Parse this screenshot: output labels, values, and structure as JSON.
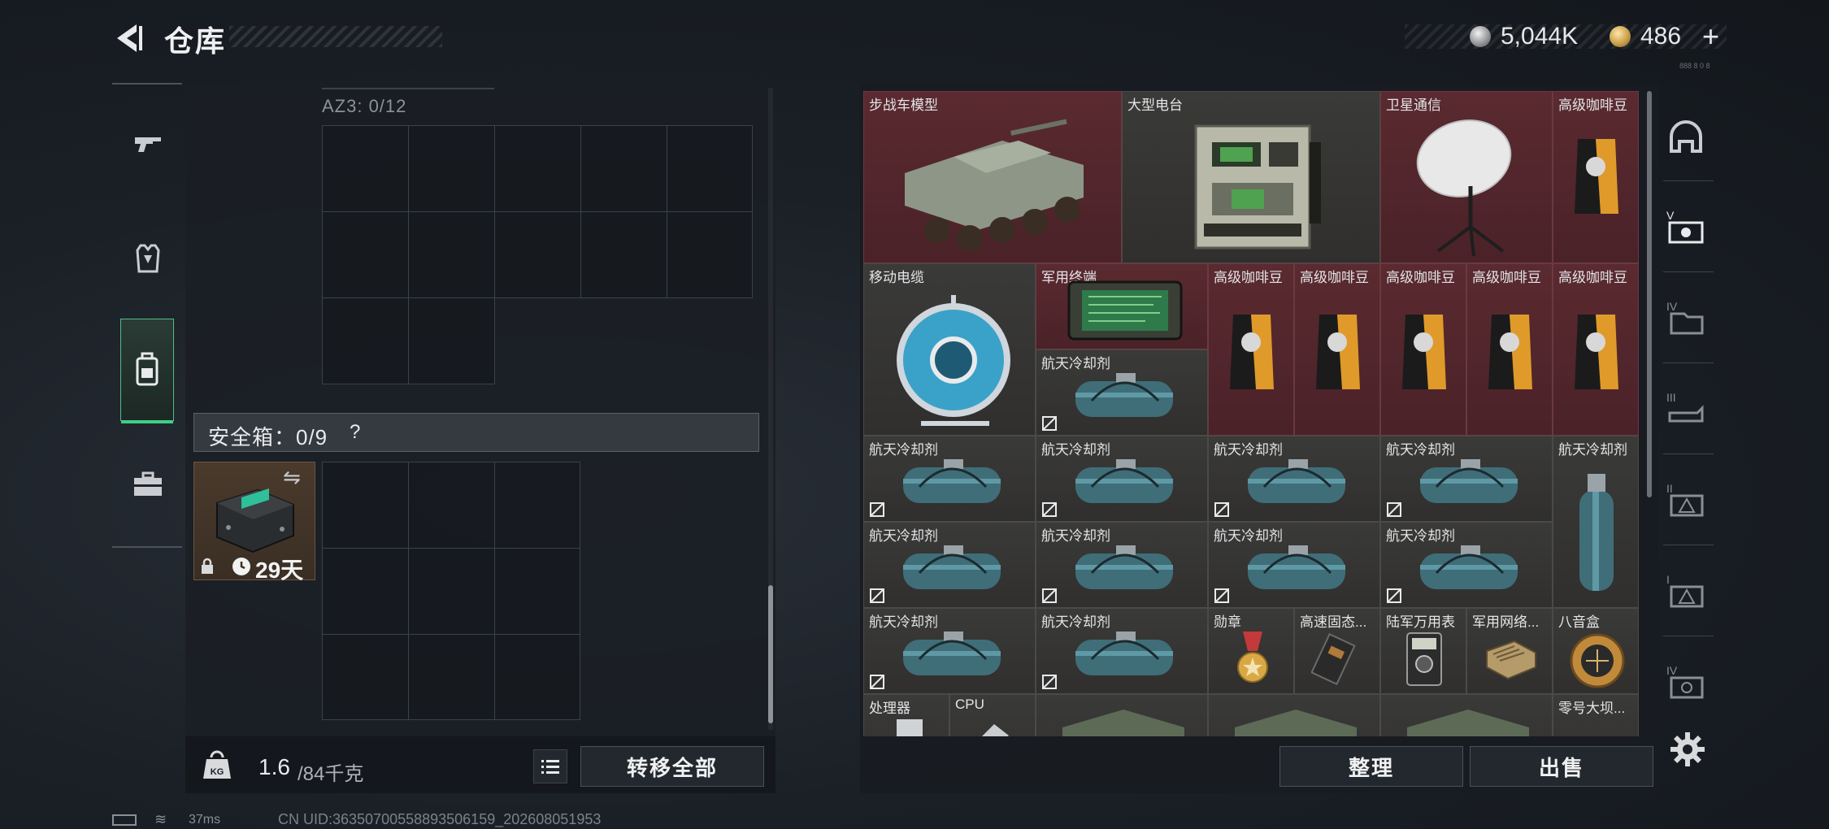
{
  "header": {
    "title": "仓库",
    "back_icon": "back-arrow-icon"
  },
  "currency": {
    "silver_value": "5,044K",
    "gold_value": "486",
    "gold_add_label": "+",
    "code_text": "888 8 0 8"
  },
  "left_rail": {
    "tabs": [
      {
        "icon": "gun-icon"
      },
      {
        "icon": "vest-icon"
      },
      {
        "icon": "backpack-icon",
        "active": true
      },
      {
        "icon": "toolbox-icon"
      }
    ]
  },
  "backpack": {
    "az3_label": "AZ3: 0/12",
    "safe_box_label": "安全箱：0/9",
    "safe_help_label": "?",
    "safe_item_days": "29天",
    "weight_current": "1.6",
    "weight_max": "/84千克",
    "transfer_all_label": "转移全部"
  },
  "warehouse": {
    "items": [
      {
        "name": "步战车模型",
        "color": "red",
        "icon": "ifv-model-icon"
      },
      {
        "name": "大型电台",
        "color": "gray",
        "icon": "radio-station-icon"
      },
      {
        "name": "卫星通信",
        "color": "red",
        "icon": "satellite-dish-icon"
      },
      {
        "name": "高级咖啡豆",
        "color": "red",
        "icon": "coffee-bag-icon"
      },
      {
        "name": "移动电缆",
        "color": "gray",
        "icon": "cable-reel-icon"
      },
      {
        "name": "军用终端",
        "color": "red",
        "icon": "military-terminal-icon"
      },
      {
        "name": "航天冷却剂",
        "color": "gray",
        "icon": "coolant-tank-icon"
      },
      {
        "name": "高级咖啡豆",
        "color": "red",
        "icon": "coffee-bag-icon"
      },
      {
        "name": "高级咖啡豆",
        "color": "red",
        "icon": "coffee-bag-icon"
      },
      {
        "name": "高级咖啡豆",
        "color": "red",
        "icon": "coffee-bag-icon"
      },
      {
        "name": "高级咖啡豆",
        "color": "red",
        "icon": "coffee-bag-icon"
      },
      {
        "name": "高级咖啡豆",
        "color": "red",
        "icon": "coffee-bag-icon"
      },
      {
        "name": "航天冷却剂",
        "color": "gray",
        "icon": "coolant-tank-icon"
      },
      {
        "name": "航天冷却剂",
        "color": "gray",
        "icon": "coolant-tank-icon"
      },
      {
        "name": "航天冷却剂",
        "color": "gray",
        "icon": "coolant-tank-icon"
      },
      {
        "name": "航天冷却剂",
        "color": "gray",
        "icon": "coolant-tank-icon"
      },
      {
        "name": "航天冷却剂",
        "color": "gray",
        "icon": "coolant-tank-icon"
      },
      {
        "name": "航天冷却剂",
        "color": "gray",
        "icon": "coolant-tank-icon"
      },
      {
        "name": "航天冷却剂",
        "color": "gray",
        "icon": "coolant-tank-icon"
      },
      {
        "name": "航天冷却剂",
        "color": "gray",
        "icon": "coolant-tank-icon"
      },
      {
        "name": "航天冷却剂",
        "color": "gray",
        "icon": "coolant-tank-icon"
      },
      {
        "name": "航天冷却剂",
        "color": "gray",
        "icon": "coolant-tank-icon"
      },
      {
        "name": "航天冷却剂",
        "color": "gray",
        "icon": "coolant-tank-icon"
      },
      {
        "name": "勋章",
        "color": "gray",
        "icon": "medal-icon"
      },
      {
        "name": "高速固态...",
        "color": "gray",
        "icon": "ssd-icon"
      },
      {
        "name": "陆军万用表",
        "color": "gray",
        "icon": "multimeter-icon"
      },
      {
        "name": "军用网络...",
        "color": "gray",
        "icon": "network-module-icon"
      },
      {
        "name": "八音盒",
        "color": "gray",
        "icon": "music-box-icon"
      },
      {
        "name": "处理器",
        "color": "gray",
        "icon": "processor-icon"
      },
      {
        "name": "CPU",
        "color": "gray",
        "icon": "cpu-icon"
      },
      {
        "name": "",
        "color": "gray",
        "icon": "crate-icon"
      },
      {
        "name": "",
        "color": "gray",
        "icon": "crate-icon"
      },
      {
        "name": "",
        "color": "gray",
        "icon": "crate-icon"
      },
      {
        "name": "零号大坝...",
        "color": "gray",
        "icon": "dam-item-icon"
      }
    ],
    "sort_label": "整理",
    "sell_label": "出售"
  },
  "right_rail": {
    "tabs": [
      {
        "icon": "helmet-tab-icon"
      },
      {
        "icon": "tab-v-icon",
        "label": "V"
      },
      {
        "icon": "tab-iv-icon",
        "label": "IV"
      },
      {
        "icon": "tab-iii-icon",
        "label": "III"
      },
      {
        "icon": "tab-ii-icon",
        "label": "II"
      },
      {
        "icon": "tab-i-icon",
        "label": "I"
      },
      {
        "icon": "tab-iv-b-icon",
        "label": "IV"
      }
    ],
    "settings_icon": "gear-icon"
  },
  "status_bar": {
    "ping": "37ms",
    "uid": "CN UID:363507005588935061​59_202608051953"
  },
  "colors": {
    "accent_green": "#3fcf86",
    "item_red": "#5a2a30",
    "item_gray": "#3a3a38"
  }
}
